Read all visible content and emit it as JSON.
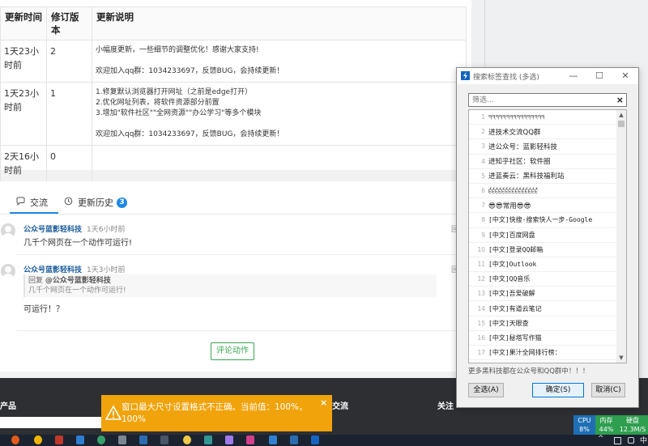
{
  "revision_table": {
    "headers": [
      "更新时间",
      "修订版本",
      "更新说明"
    ],
    "rows": [
      {
        "time": "1天23小时前",
        "version": "2",
        "notes": [
          "小幅度更新，一些细节的调整优化！感谢大家支持!",
          "",
          "欢迎加入qq群：1034233697，反馈BUG，会持续更新！"
        ]
      },
      {
        "time": "1天23小时前",
        "version": "1",
        "notes": [
          "1.修复默认浏览器打开网址（之前是edge打开）",
          "2.优化网址列表，将软件资源部分前置",
          "3.增加\"软件社区\"\"全网资源\"\"办公学习\"等多个模块",
          "",
          "欢迎加入qq群：1034233697，反馈BUG，会持续更新！"
        ]
      },
      {
        "time": "2天16小时前",
        "version": "0",
        "notes": []
      }
    ]
  },
  "comments_panel": {
    "tabs": [
      {
        "label": "交流",
        "icon": "chat-bubble-icon"
      },
      {
        "label": "更新历史",
        "icon": "history-icon",
        "badge": "3"
      }
    ],
    "comments": [
      {
        "author": "公众号蓝影轻科技",
        "time": "1天6小时前",
        "text": "几千个网页在一个动作可运行!",
        "reply_mark": "回"
      },
      {
        "author": "公众号蓝影轻科技",
        "time": "1天3小时前",
        "text": "可运行！？",
        "reply_mark": "回",
        "quote": {
          "prefix": "回复",
          "author": "@公众号蓝影轻科技",
          "text": "几千个网页在一个动作可运行!"
        }
      }
    ],
    "comment_button": "评论动作"
  },
  "footer": {
    "heading_left": "产品",
    "heading_mid": "交流",
    "heading_right": "关注"
  },
  "toast": {
    "message": "窗口最大尺寸设置格式不正确。当前值：100%，100%",
    "close": "×",
    "color": "#f0a30a"
  },
  "dialog": {
    "title": "搜索标签查找 (多选)",
    "app_icon": "lightning-icon",
    "win_controls": {
      "minimize": "—",
      "maximize": "☐",
      "close": "✕"
    },
    "filter_placeholder": "筛选...",
    "filter_clear": "×",
    "items": [
      {
        "num": "1",
        "label": "੧੧੧੧੧੧੧੧੧੧੧੧੧੧੧੧"
      },
      {
        "num": "2",
        "label": "进技术交流QQ群"
      },
      {
        "num": "3",
        "label": "进公众号：蓝影轻科技"
      },
      {
        "num": "4",
        "label": "进知乎社区：软件圈"
      },
      {
        "num": "5",
        "label": "进蓝奏云：黑科技福利站"
      },
      {
        "num": "6",
        "label": "੬੬੬੬੬੬੬੬੬੬੬੬੬੬੬"
      },
      {
        "num": "7",
        "label": "😎😎常用😎😎"
      },
      {
        "num": "8",
        "label": "[中文]快搜-搜索快人一步-Google"
      },
      {
        "num": "9",
        "label": "[中文]百度网盘"
      },
      {
        "num": "10",
        "label": "[中文]登录QQ邮箱"
      },
      {
        "num": "11",
        "label": "[中文]Outlook"
      },
      {
        "num": "12",
        "label": "[中文]QQ音乐"
      },
      {
        "num": "13",
        "label": "[中文]吾爱破解"
      },
      {
        "num": "14",
        "label": "[中文]有道云笔记"
      },
      {
        "num": "15",
        "label": "[中文]天眼查"
      },
      {
        "num": "16",
        "label": "[中文]秘塔写作猫"
      },
      {
        "num": "17",
        "label": "[中文]果汁全网排行榜："
      }
    ],
    "hint": "更多黑科技都在公众号和QQ群中！！！",
    "buttons": {
      "select_all": "全选(A)",
      "ok": "确定(S)",
      "cancel": "取消(C)"
    }
  },
  "system_widget": {
    "cpu_label": "CPU",
    "cpu_value": "8%",
    "mem_label": "内存",
    "mem_value": "44%",
    "disk_label": "硬盘",
    "disk_value": "12.3M/S"
  },
  "taskbar": {
    "tray_caret": "^",
    "tray_ime": "中"
  }
}
